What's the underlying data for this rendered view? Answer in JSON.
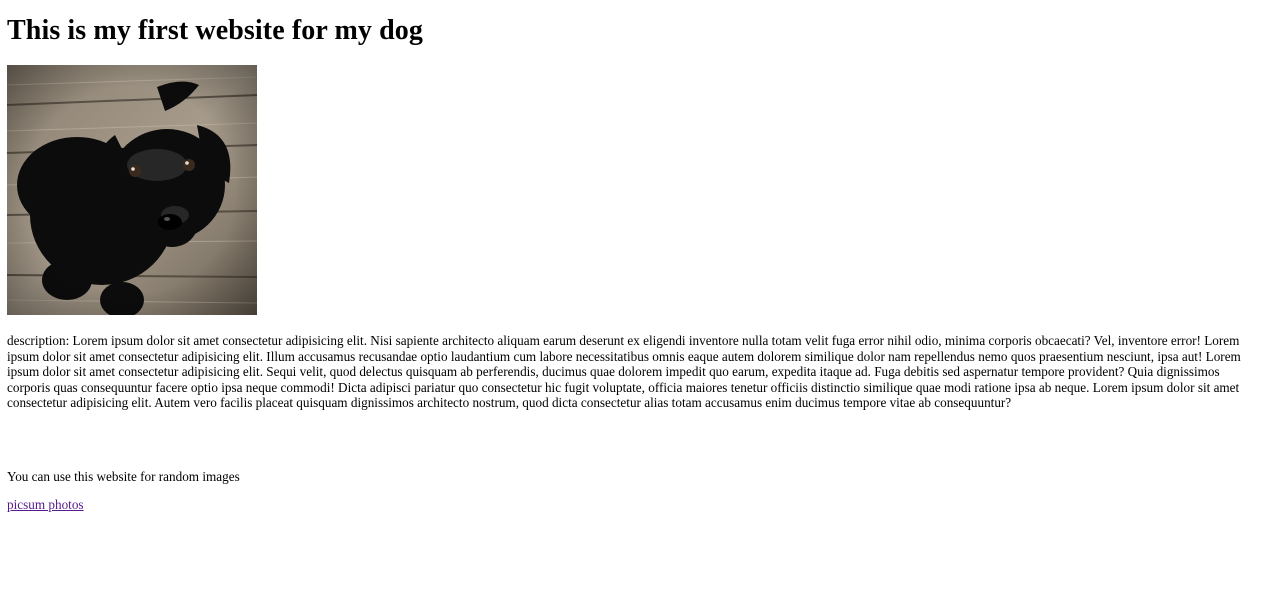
{
  "page": {
    "heading": "This is my first website for my dog",
    "image": {
      "description": "black puppy on wooden floor",
      "icon": "dog-photo"
    },
    "description": "description: Lorem ipsum dolor sit amet consectetur adipisicing elit. Nisi sapiente architecto aliquam earum deserunt ex eligendi inventore nulla totam velit fuga error nihil odio, minima corporis obcaecati? Vel, inventore error! Lorem ipsum dolor sit amet consectetur adipisicing elit. Illum accusamus recusandae optio laudantium cum labore necessitatibus omnis eaque autem dolorem similique dolor nam repellendus nemo quos praesentium nesciunt, ipsa aut! Lorem ipsum dolor sit amet consectetur adipisicing elit. Sequi velit, quod delectus quisquam ab perferendis, ducimus quae dolorem impedit quo earum, expedita itaque ad. Fuga debitis sed aspernatur tempore provident? Quia dignissimos corporis quas consequuntur facere optio ipsa neque commodi! Dicta adipisci pariatur quo consectetur hic fugit voluptate, officia maiores tenetur officiis distinctio similique quae modi ratione ipsa ab neque. Lorem ipsum dolor sit amet consectetur adipisicing elit. Autem vero facilis placeat quisquam dignissimos architecto nostrum, quod dicta consectetur alias totam accusamus enim ducimus tempore vitae ab consequuntur?",
    "note": "You can use this website for random images",
    "link_text": "picsum photos"
  },
  "colors": {
    "visited_link": "#551a8b",
    "text": "#000000",
    "background": "#ffffff"
  }
}
